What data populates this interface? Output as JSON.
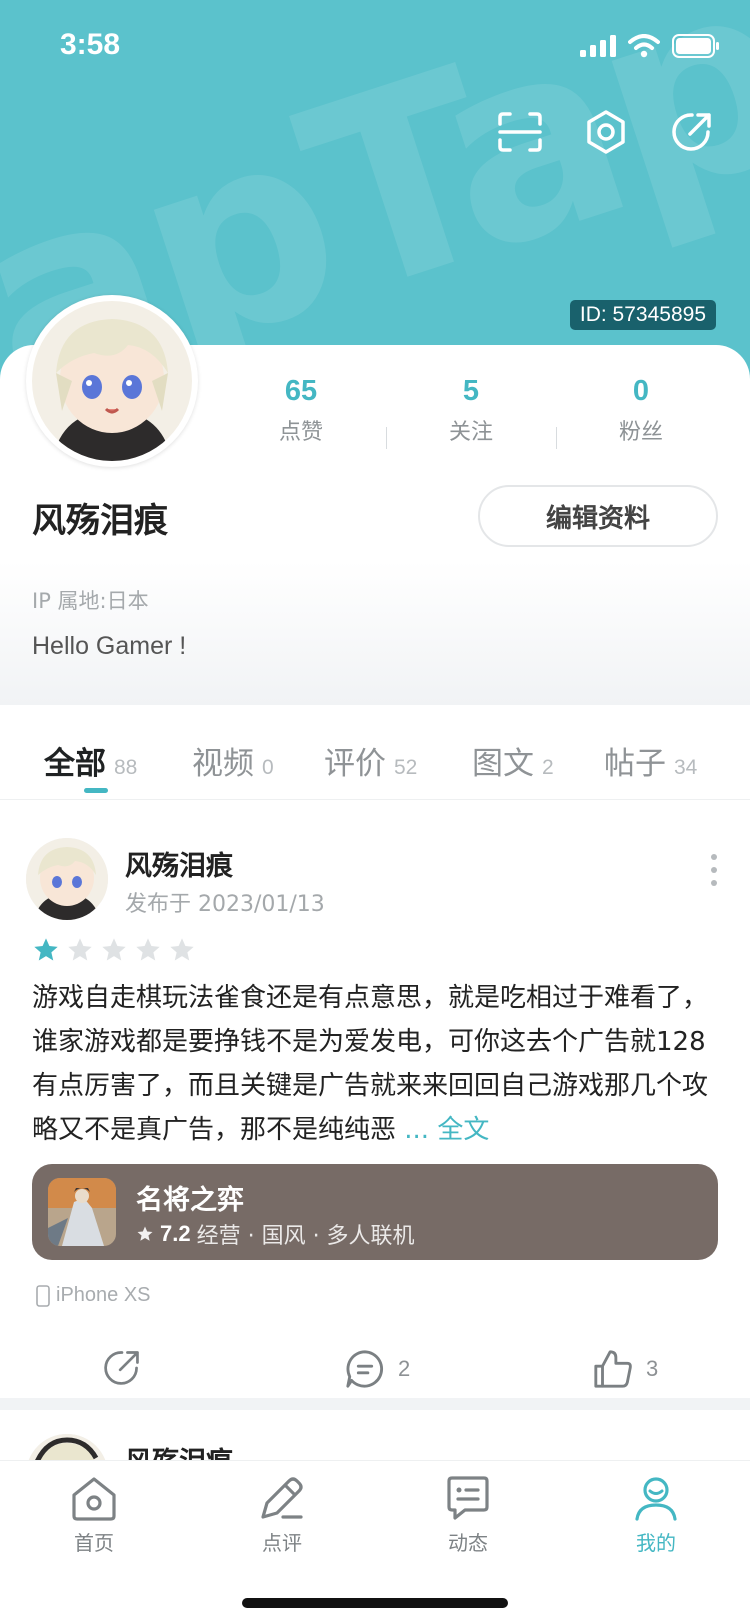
{
  "status_bar": {
    "time": "3:58"
  },
  "header": {
    "watermark": "apTap",
    "user_id": "ID: 57345895",
    "actions": [
      "scan-icon",
      "settings-icon",
      "share-icon"
    ]
  },
  "profile": {
    "stats": [
      {
        "value": "65",
        "label": "点赞"
      },
      {
        "value": "5",
        "label": "关注"
      },
      {
        "value": "0",
        "label": "粉丝"
      }
    ],
    "username": "风殇泪痕",
    "edit_button": "编辑资料",
    "ip_location": "IP 属地:日本",
    "bio": "Hello Gamer !"
  },
  "tabs": [
    {
      "label": "全部",
      "count": "88",
      "active": true
    },
    {
      "label": "视频",
      "count": "0"
    },
    {
      "label": "评价",
      "count": "52"
    },
    {
      "label": "图文",
      "count": "2"
    },
    {
      "label": "帖子",
      "count": "34"
    }
  ],
  "post": {
    "author": "风殇泪痕",
    "date": "发布于 2023/01/13",
    "rating": 1,
    "rating_max": 5,
    "text": "游戏自走棋玩法雀食还是有点意思，就是吃相过于难看了，谁家游戏都是要挣钱不是为爱发电，可你这去个广告就128有点厉害了，而且关键是广告就来来回回自己游戏那几个攻略又不是真广告，那不是纯纯恶",
    "more_label": "... 全文",
    "game": {
      "name": "名将之弈",
      "rating": "7.2",
      "tags": "经营 · 国风 · 多人联机"
    },
    "device": "iPhone XS",
    "comments": "2",
    "likes": "3"
  },
  "next_post": {
    "author": "风殇泪痕"
  },
  "tabbar": [
    {
      "label": "首页",
      "icon": "home-icon"
    },
    {
      "label": "点评",
      "icon": "review-icon"
    },
    {
      "label": "动态",
      "icon": "feed-icon"
    },
    {
      "label": "我的",
      "icon": "profile-icon",
      "active": true
    }
  ],
  "colors": {
    "accent": "#44b7c3",
    "header": "#5bc2cc",
    "game_card": "#776b66"
  }
}
